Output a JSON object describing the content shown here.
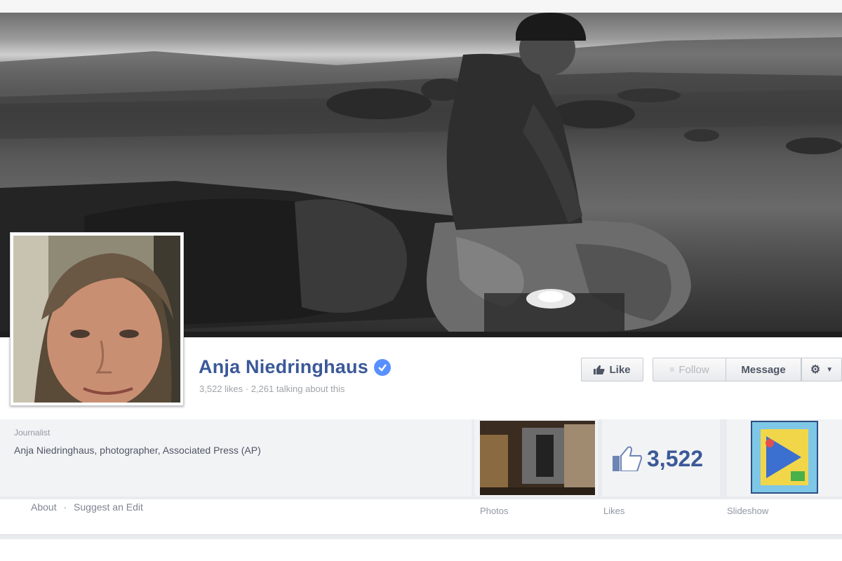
{
  "colors": {
    "brand": "#3b5998",
    "verified": "#5890ff",
    "muted": "#9197a3"
  },
  "page": {
    "name": "Anja Niedringhaus",
    "verified_icon": "verified-badge-icon",
    "stats_line": "3,522 likes · 2,261 talking about this"
  },
  "actions": {
    "like_label": "Like",
    "follow_label": "Follow",
    "message_label": "Message",
    "gear_icon": "gear-icon"
  },
  "about": {
    "category": "Journalist",
    "description": "Anja Niedringhaus, photographer, Associated Press (AP)",
    "about_link": "About",
    "separator": "·",
    "suggest_link": "Suggest an Edit"
  },
  "tiles": {
    "photos_label": "Photos",
    "likes_label": "Likes",
    "likes_count": "3,522",
    "slideshow_label": "Slideshow"
  }
}
